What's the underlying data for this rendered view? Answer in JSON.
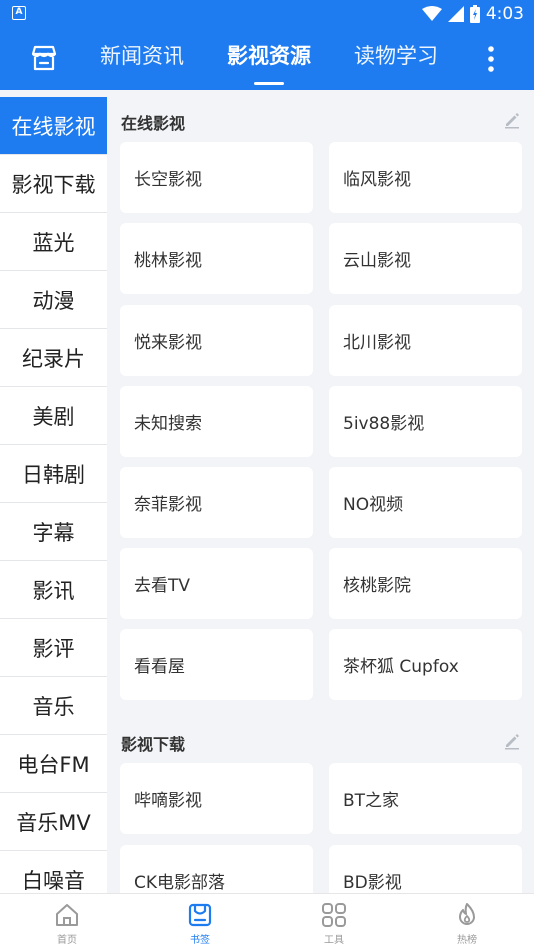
{
  "status": {
    "time": "4:03",
    "notif_glyph": "A"
  },
  "header": {
    "tabs": [
      {
        "label": "新闻资讯"
      },
      {
        "label": "影视资源"
      },
      {
        "label": "读物学习"
      }
    ],
    "active_tab": 1
  },
  "sidebar": {
    "items": [
      {
        "label": "在线影视"
      },
      {
        "label": "影视下载"
      },
      {
        "label": "蓝光"
      },
      {
        "label": "动漫"
      },
      {
        "label": "纪录片"
      },
      {
        "label": "美剧"
      },
      {
        "label": "日韩剧"
      },
      {
        "label": "字幕"
      },
      {
        "label": "影讯"
      },
      {
        "label": "影评"
      },
      {
        "label": "音乐"
      },
      {
        "label": "电台FM"
      },
      {
        "label": "音乐MV"
      },
      {
        "label": "白噪音"
      }
    ],
    "active_index": 0
  },
  "sections": [
    {
      "title": "在线影视",
      "cards": [
        "长空影视",
        "临风影视",
        "桃林影视",
        "云山影视",
        "悦来影视",
        "北川影视",
        "未知搜索",
        "5iv88影视",
        "奈菲影视",
        "NO视频",
        "去看TV",
        "核桃影院",
        "看看屋",
        "茶杯狐 Cupfox"
      ]
    },
    {
      "title": "影视下载",
      "cards": [
        "哔嘀影视",
        "BT之家",
        "CK电影部落",
        "BD影视"
      ]
    }
  ],
  "bottom_nav": [
    {
      "label": "首页",
      "icon": "home-icon"
    },
    {
      "label": "书签",
      "icon": "bookmark-icon"
    },
    {
      "label": "工具",
      "icon": "tools-icon"
    },
    {
      "label": "热榜",
      "icon": "fire-icon"
    }
  ],
  "colors": {
    "primary": "#1f7cf0",
    "background": "#f2f4f7",
    "card": "#ffffff"
  }
}
